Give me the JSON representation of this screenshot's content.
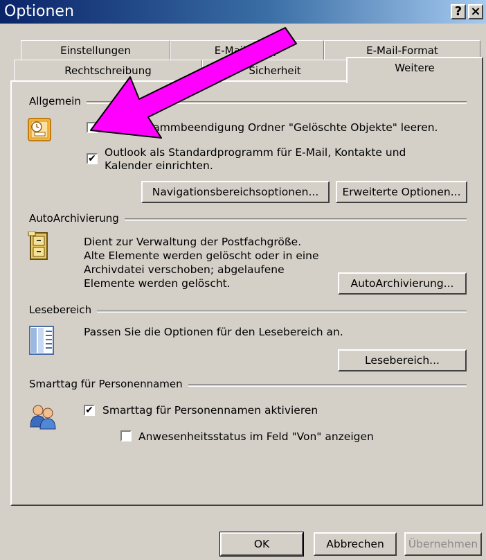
{
  "window": {
    "title": "Optionen",
    "help_glyph": "?",
    "close_glyph": "×"
  },
  "tabs_row1": [
    "Einstellungen",
    "E-Mail-Setup",
    "E-Mail-Format"
  ],
  "tabs_row2": [
    "Rechtschreibung",
    "Sicherheit",
    "Weitere"
  ],
  "sections": {
    "allgemein": {
      "header": "Allgemein",
      "checkbox1": {
        "label": "Bei Programmbeendigung Ordner \"Gelöschte Objekte\" leeren.",
        "checked": false
      },
      "checkbox2": {
        "label_line1": "Outlook als Standardprogramm für E-Mail, Kontakte und",
        "label_line2": "Kalender einrichten.",
        "checked": true
      },
      "nav_button": "Navigationsbereichsoptionen...",
      "adv_button": "Erweiterte Optionen..."
    },
    "autoarchiv": {
      "header": "AutoArchivierung",
      "line1": "Dient zur Verwaltung der Postfachgröße.",
      "line2": "Alte Elemente werden gelöscht oder in eine",
      "line3": "Archivdatei verschoben; abgelaufene",
      "line4": "Elemente werden gelöscht.",
      "button": "AutoArchivierung..."
    },
    "lesebereich": {
      "header": "Lesebereich",
      "text": "Passen Sie die Optionen für den Lesebereich an.",
      "button": "Lesebereich..."
    },
    "smarttag": {
      "header": "Smarttag für Personennamen",
      "checkbox1": {
        "label": "Smarttag für Personennamen aktivieren",
        "checked": true
      },
      "checkbox2": {
        "label": "Anwesenheitsstatus im Feld \"Von\" anzeigen",
        "checked": false
      }
    }
  },
  "footer": {
    "ok": "OK",
    "cancel": "Abbrechen",
    "apply": "Übernehmen"
  },
  "colors": {
    "title_bar": "#0a246a",
    "dialog_bg": "#d4d0c8",
    "arrow": "#ff00ff",
    "check_mark": "✔"
  }
}
